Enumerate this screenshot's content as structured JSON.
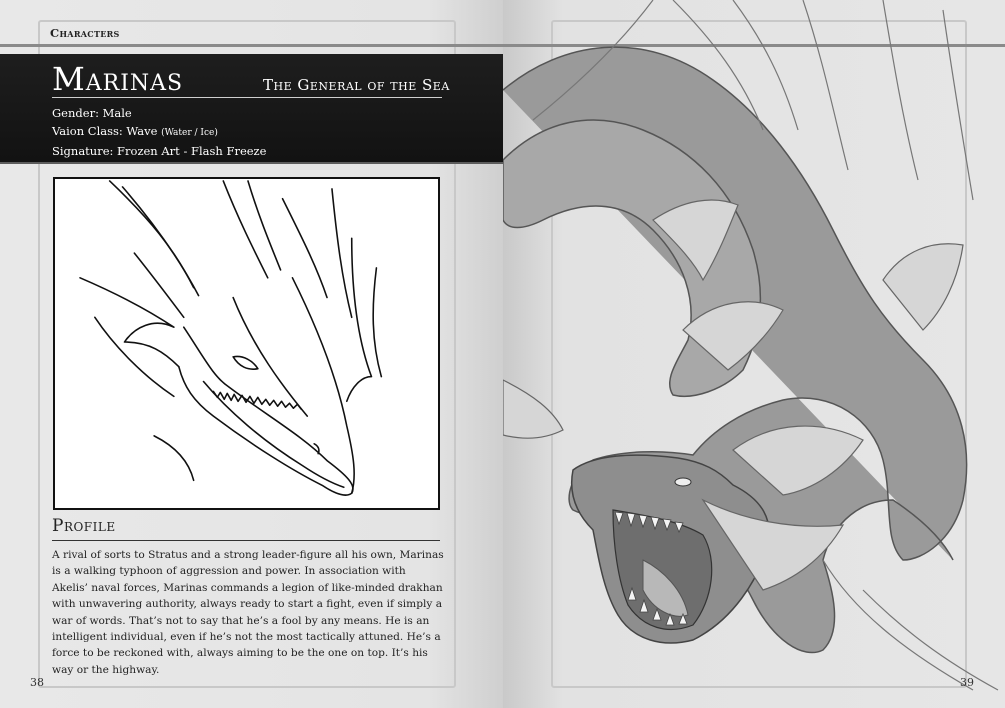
{
  "header": {
    "section": "Characters"
  },
  "character": {
    "name": "Marinas",
    "title": "The General of the Sea",
    "gender_label": "Gender: Male",
    "class_label": "Vaion Class: Wave",
    "class_detail": "(Water / Ice)",
    "signature_label": "Signature: Frozen Art - Flash Freeze"
  },
  "profile": {
    "heading": "Profile",
    "text": "A rival of sorts to Stratus and a strong leader-figure all his own, Marinas is a walking typhoon of aggression and power. In association with Akelis’ naval forces, Marinas commands a legion of like-minded drakhan with unwavering authority, always ready to start a fight, even if simply a war of words. That’s not to say that he’s a fool by any means. He is an intelligent individual, even if he’s not the most tactically attuned. He’s a force to be reckoned with, always aiming to be the one on top. It’s his way or the highway."
  },
  "pages": {
    "left": "38",
    "right": "39"
  },
  "colors": {
    "banner": "#151515",
    "paper": "#e6e6e6",
    "frame": "#c8c8c8"
  },
  "icons": {
    "portrait": "dragon-head-sketch",
    "illustration": "sea-dragon-illustration"
  }
}
